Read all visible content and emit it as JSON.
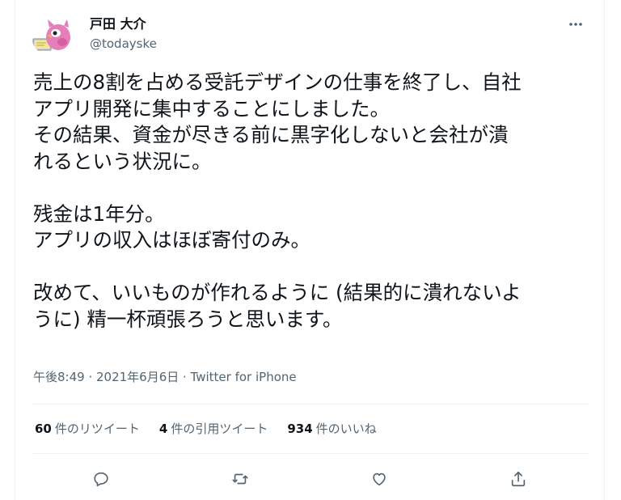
{
  "user": {
    "display_name": "戸田 大介",
    "handle": "@todayske",
    "avatar_icon": "pink-bird-avatar-icon"
  },
  "tweet": {
    "text": "売上の8割を占める受託デザインの仕事を終了し、自社\nアプリ開発に集中することにしました。\nその結果、資金が尽きる前に黒字化しないと会社が潰\nれるという状況に。\n\n残金は1年分。\nアプリの収入はほぼ寄付のみ。\n\n改めて、いいものが作れるように (結果的に潰れないよ\nうに) 精一杯頑張ろうと思います。",
    "meta": "午後8:49 · 2021年6月6日 · Twitter for iPhone"
  },
  "stats": {
    "retweets_count": "60",
    "retweets_label": "件のリツイート",
    "quotes_count": "4",
    "quotes_label": "件の引用ツイート",
    "likes_count": "934",
    "likes_label": "件のいいね"
  },
  "actions": {
    "reply_icon": "reply-icon",
    "retweet_icon": "retweet-icon",
    "like_icon": "heart-icon",
    "share_icon": "share-icon",
    "more_icon": "more-icon"
  },
  "colors": {
    "text_primary": "#0f1419",
    "text_secondary": "#536471",
    "divider": "#eff3f4",
    "avatar_pink": "#e57fb7"
  }
}
